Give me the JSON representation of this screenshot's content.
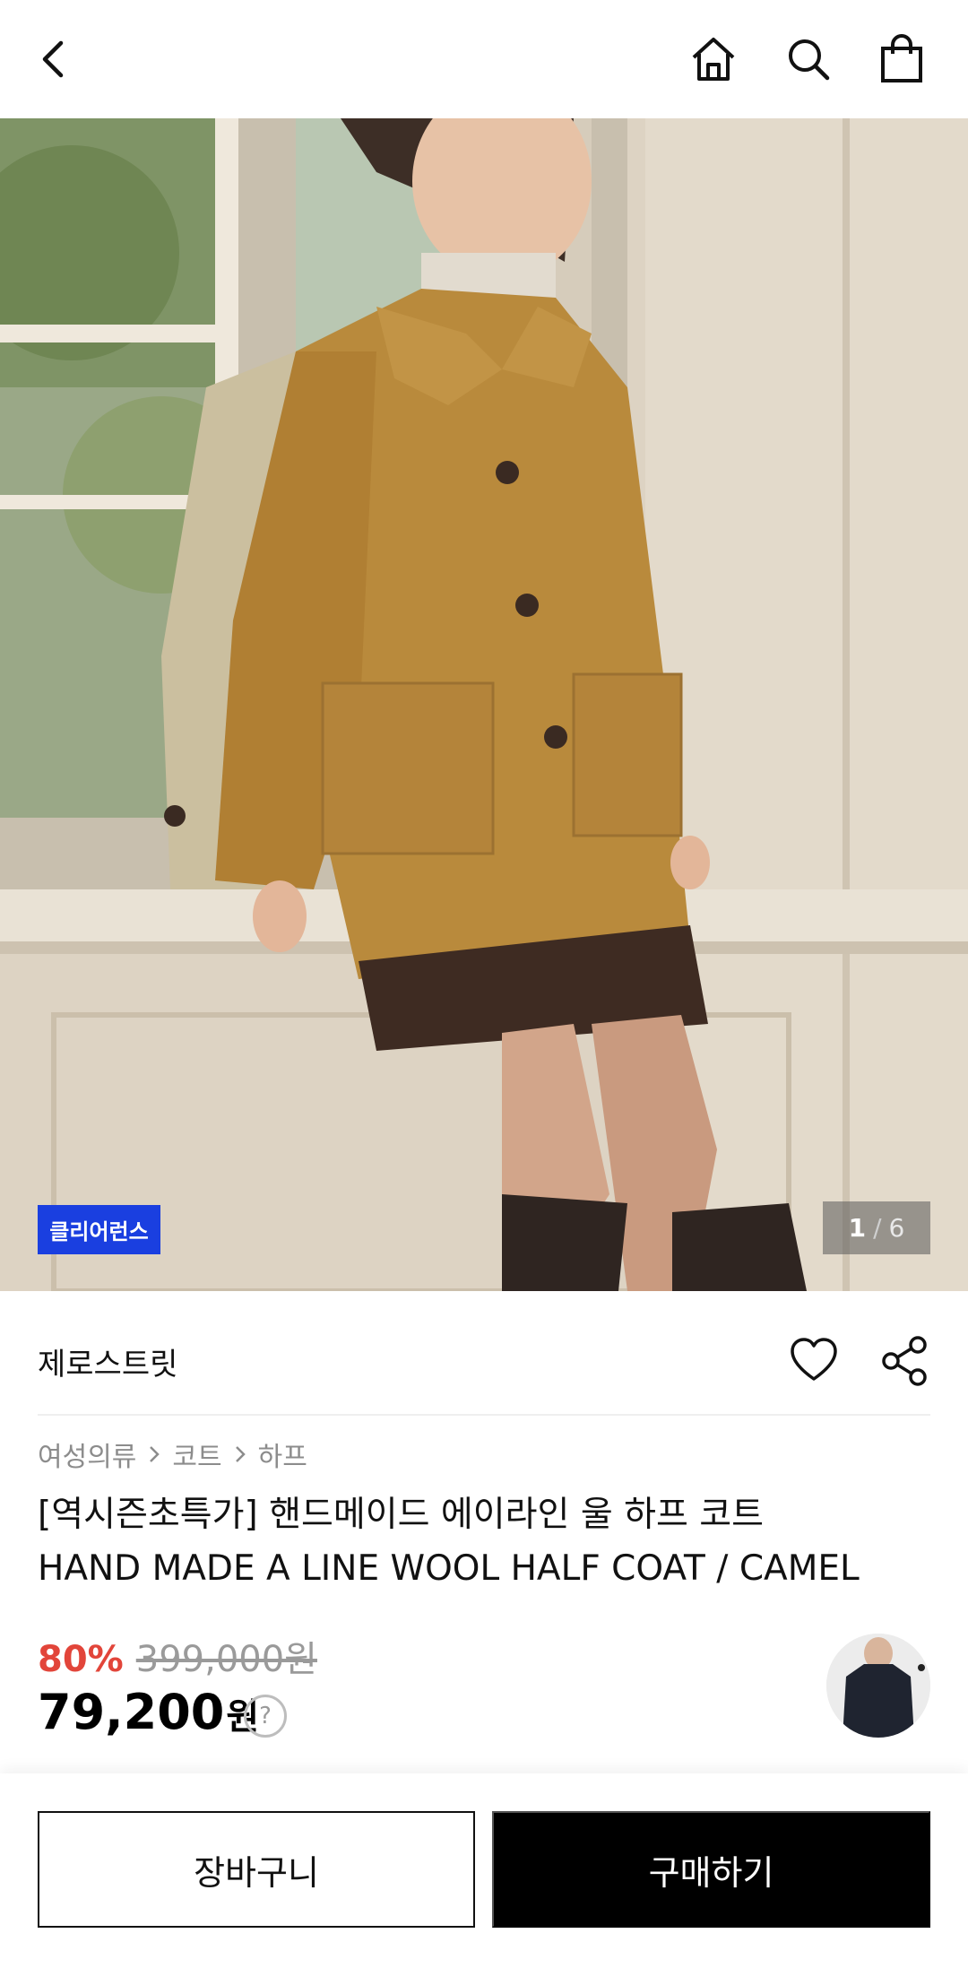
{
  "header": {
    "icons": [
      "back-arrow-icon",
      "home-icon",
      "search-icon",
      "shopping-bag-icon"
    ]
  },
  "gallery": {
    "badge": "클리어런스",
    "current": "1",
    "separator": "/",
    "total": "6"
  },
  "product": {
    "brand": "제로스트릿",
    "breadcrumb": [
      "여성의류",
      "코트",
      "하프"
    ],
    "title_line1": "[역시즌초특가] 핸드메이드 에이라인 울 하프 코트",
    "title_line2": "HAND MADE A LINE WOOL HALF COAT / CAMEL",
    "discount": "80%",
    "original_price": "399,000원",
    "final_price": "79,200",
    "currency": "원",
    "price_help": "?"
  },
  "actions": {
    "cart": "장바구니",
    "buy": "구매하기"
  },
  "colors": {
    "badge_blue": "#1a3fe0",
    "discount_red": "#e2453a",
    "buy_black": "#000000"
  }
}
